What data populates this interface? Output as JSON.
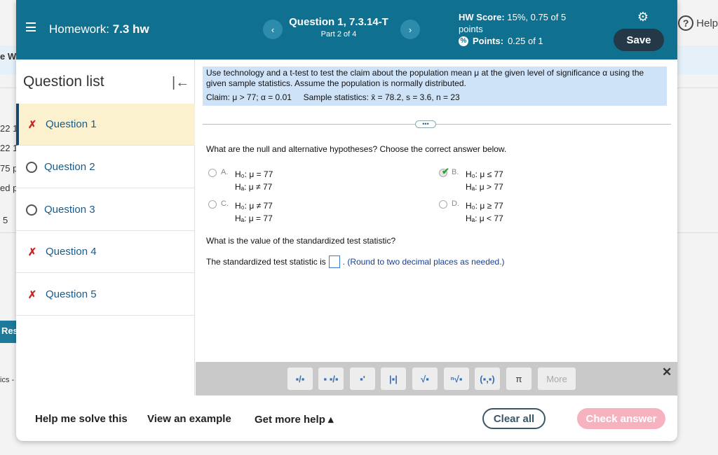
{
  "background": {
    "help_label": "Help",
    "fragments": [
      "e W",
      "22 1",
      "22 1",
      "75 p",
      "ed p",
      "5",
      "Res",
      "ics -"
    ]
  },
  "header": {
    "homework_label": "Homework:",
    "homework_name": "7.3 hw",
    "question_title": "Question 1, 7.3.14-T",
    "question_part": "Part 2 of 4",
    "hw_score_label": "HW Score:",
    "hw_score_value": "15%, 0.75 of 5 points",
    "points_label": "Points:",
    "points_value": "0.25 of 1",
    "prev_symbol": "‹",
    "next_symbol": "›",
    "save_label": "Save"
  },
  "sidebar": {
    "title": "Question list",
    "items": [
      {
        "label": "Question 1",
        "status": "partial"
      },
      {
        "label": "Question 2",
        "status": "unanswered"
      },
      {
        "label": "Question 3",
        "status": "unanswered"
      },
      {
        "label": "Question 4",
        "status": "partial"
      },
      {
        "label": "Question 5",
        "status": "partial"
      }
    ]
  },
  "question": {
    "prompt": "Use technology and a t-test to test the claim about the population mean μ at the given level of significance α using the given sample statistics. Assume the population is normally distributed.",
    "claim": "Claim: μ > 77; α = 0.01",
    "sample_stats": "Sample statistics: x̄ = 78.2, s = 3.6, n = 23",
    "dots": "•••",
    "hypotheses_question": "What are the null and alternative hypotheses? Choose the correct answer below.",
    "choices": [
      {
        "letter": "A.",
        "h0": "H₀: μ = 77",
        "ha": "Hₐ: μ ≠ 77",
        "selected": false
      },
      {
        "letter": "B.",
        "h0": "H₀: μ ≤ 77",
        "ha": "Hₐ: μ > 77",
        "selected": true
      },
      {
        "letter": "C.",
        "h0": "H₀: μ ≠ 77",
        "ha": "Hₐ: μ = 77",
        "selected": false
      },
      {
        "letter": "D.",
        "h0": "H₀: μ ≥ 77",
        "ha": "Hₐ: μ < 77",
        "selected": false
      }
    ],
    "statistic_question": "What is the value of the standardized test statistic?",
    "answer_prefix": "The standardized test statistic is",
    "answer_value": "",
    "answer_note": ". (Round to two decimal places as needed.)"
  },
  "math_toolbar": {
    "buttons": [
      "▪/▪",
      "▪ ▪/▪",
      "▪'",
      "|▪|",
      "√▪",
      "ⁿ√▪",
      "(▪,▪)",
      "π",
      "More"
    ],
    "close_symbol": "✕"
  },
  "footer": {
    "help_solve": "Help me solve this",
    "view_example": "View an example",
    "get_more_help": "Get more help ▴",
    "clear_all": "Clear all",
    "check_answer": "Check answer"
  }
}
